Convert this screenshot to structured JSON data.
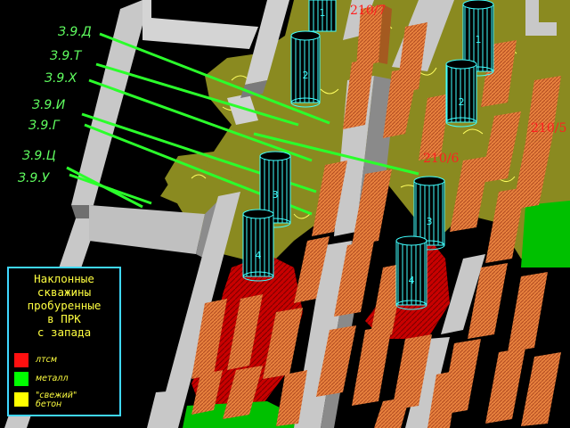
{
  "well_labels": [
    "З.9.Д",
    "З.9.Т",
    "З.9.Х",
    "З.9.И",
    "З.9.Г",
    "З.9.Ц",
    "З.9.У"
  ],
  "rooms": [
    "210/7",
    "210/5",
    "210/6"
  ],
  "columns": [
    "1",
    "1",
    "2",
    "2",
    "3",
    "3",
    "4",
    "4"
  ],
  "legend": {
    "title": "Наклонные\nскважины\nпробуренные\nв ПРК\nс запада",
    "items": [
      {
        "label": "лтсм",
        "color": "#ff1010"
      },
      {
        "label": "металл",
        "color": "#00ff00"
      },
      {
        "label": "\"свежий\"\nбетон",
        "color": "#ffff00"
      }
    ]
  },
  "colors": {
    "background": "#000000",
    "label_text": "#60ff60",
    "well_line": "#2bff2b",
    "room_text": "#ff2020",
    "legend_border": "#3fd8ff",
    "legend_text": "#ffff40",
    "concrete_fill": "#8a8a20",
    "column_outline": "#40ffff",
    "gray_block": "#c8c8c8",
    "orange_block": "#e07a3c"
  }
}
